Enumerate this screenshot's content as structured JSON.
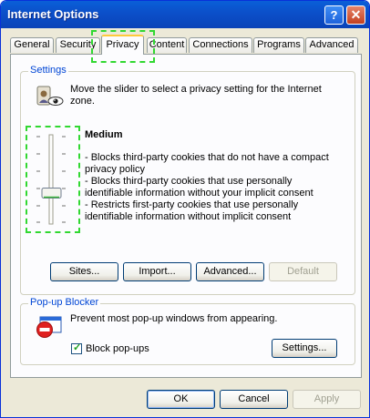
{
  "window": {
    "title": "Internet Options"
  },
  "titlebar": {
    "help": "?",
    "close": "✕"
  },
  "tabs": [
    {
      "label": "General"
    },
    {
      "label": "Security"
    },
    {
      "label": "Privacy"
    },
    {
      "label": "Content"
    },
    {
      "label": "Connections"
    },
    {
      "label": "Programs"
    },
    {
      "label": "Advanced"
    }
  ],
  "settings": {
    "legend": "Settings",
    "instruction": "Move the slider to select a privacy setting for the Internet zone.",
    "level": "Medium",
    "level_value": 0.5,
    "descriptions": [
      "- Blocks third-party cookies that do not have a compact privacy policy",
      "- Blocks third-party cookies that use personally identifiable information without your implicit consent",
      "- Restricts first-party cookies that use personally identifiable information without implicit consent"
    ],
    "buttons": {
      "sites": "Sites...",
      "import": "Import...",
      "advanced": "Advanced...",
      "default": "Default"
    }
  },
  "popup": {
    "legend": "Pop-up Blocker",
    "description": "Prevent most pop-up windows from appearing.",
    "checkbox_label": "Block pop-ups",
    "checked": true,
    "settings_button": "Settings..."
  },
  "footer": {
    "ok": "OK",
    "cancel": "Cancel",
    "apply": "Apply"
  },
  "colors": {
    "title_bar": "#0a54d4",
    "legend": "#0046d5",
    "highlight": "#31d831",
    "active_tab_accent": "#ffc83c"
  }
}
